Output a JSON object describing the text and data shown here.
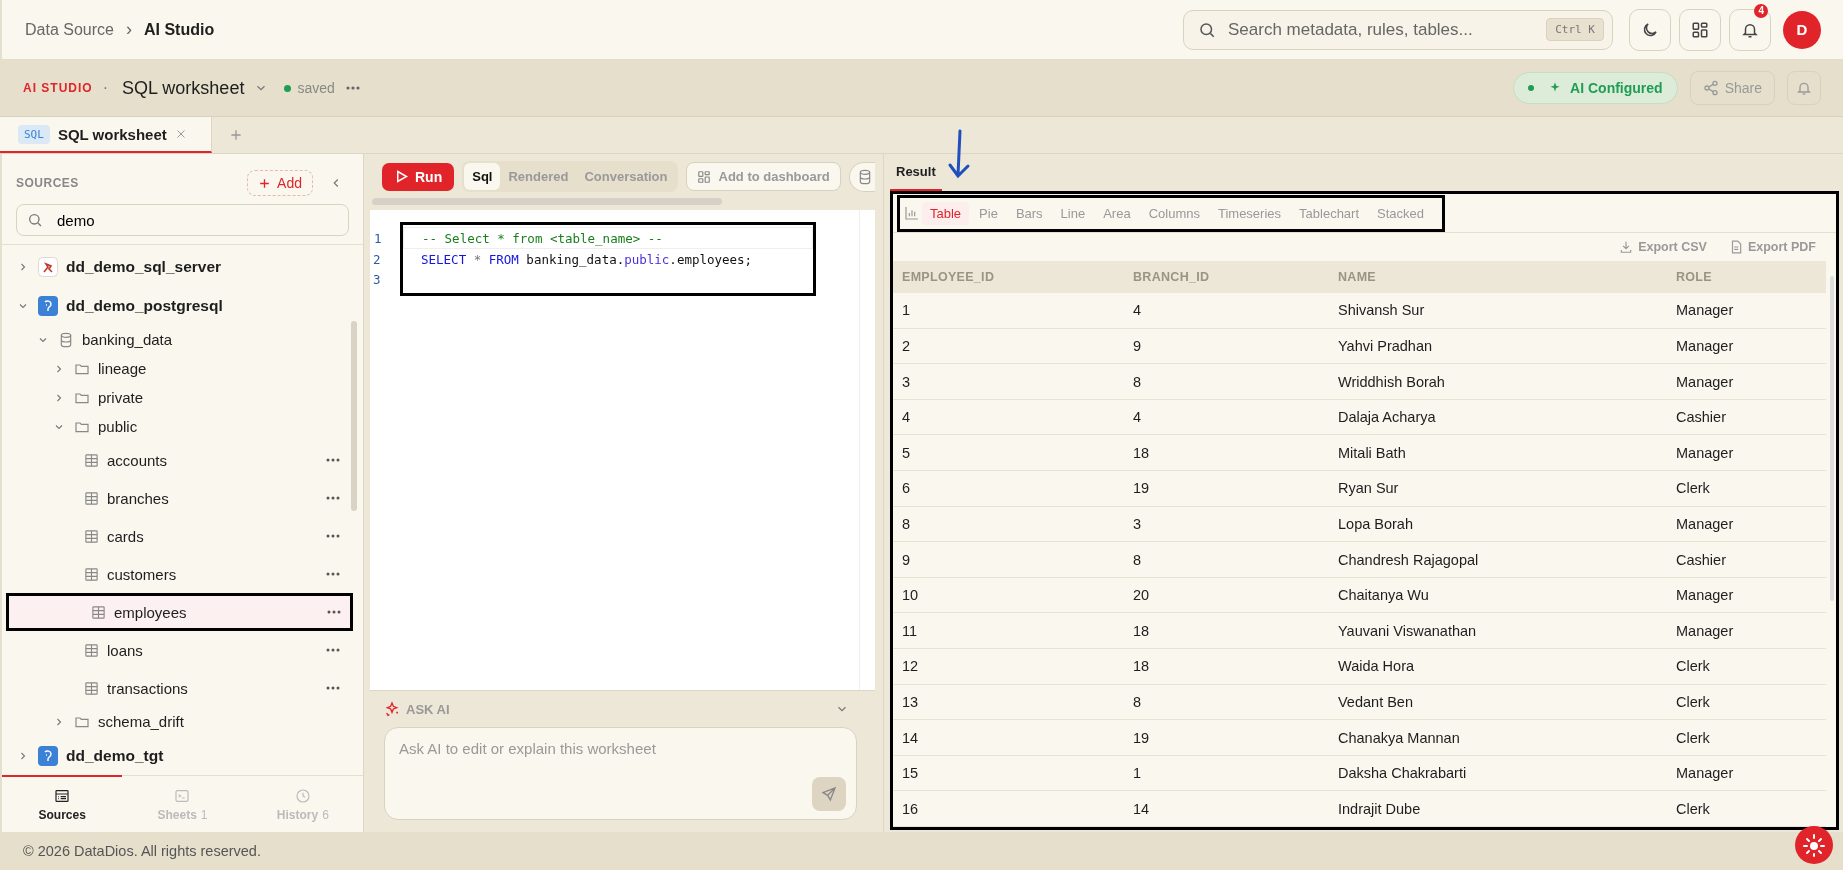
{
  "breadcrumb": {
    "parent": "Data Source",
    "separator": "›",
    "current": "AI Studio"
  },
  "search": {
    "placeholder": "Search metadata, rules, tables...",
    "shortcut": "Ctrl K"
  },
  "notifications": {
    "count": "4"
  },
  "avatar": {
    "initial": "D"
  },
  "worksheet_bar": {
    "brand": "AI STUDIO",
    "dot": "·",
    "title": "SQL worksheet",
    "status": "saved",
    "ai_status": "AI Configured",
    "share": "Share"
  },
  "tabs": [
    {
      "badge": "SQL",
      "label": "SQL worksheet",
      "selected": true
    }
  ],
  "sidebar": {
    "title": "SOURCES",
    "add": "Add",
    "search_value": "demo",
    "tree": [
      {
        "label": "dd_demo_sql_server",
        "kind": "sqlserver",
        "expanded": false
      },
      {
        "label": "dd_demo_postgresql",
        "kind": "postgres",
        "expanded": true,
        "children": [
          {
            "label": "banking_data",
            "kind": "database",
            "expanded": true,
            "children": [
              {
                "label": "lineage",
                "kind": "folder",
                "expanded": false
              },
              {
                "label": "private",
                "kind": "folder",
                "expanded": false
              },
              {
                "label": "public",
                "kind": "folder",
                "expanded": true,
                "children": [
                  {
                    "label": "accounts",
                    "kind": "table",
                    "selected": false,
                    "highlighted": false
                  },
                  {
                    "label": "branches",
                    "kind": "table",
                    "selected": false,
                    "highlighted": false
                  },
                  {
                    "label": "cards",
                    "kind": "table",
                    "selected": false,
                    "highlighted": false
                  },
                  {
                    "label": "customers",
                    "kind": "table",
                    "selected": false,
                    "highlighted": false
                  },
                  {
                    "label": "employees",
                    "kind": "table",
                    "selected": true,
                    "highlighted": true
                  },
                  {
                    "label": "loans",
                    "kind": "table",
                    "selected": false,
                    "highlighted": false
                  },
                  {
                    "label": "transactions",
                    "kind": "table",
                    "selected": false,
                    "highlighted": false
                  }
                ]
              },
              {
                "label": "schema_drift",
                "kind": "folder",
                "expanded": false
              }
            ]
          }
        ]
      },
      {
        "label": "dd_demo_tgt",
        "kind": "postgres",
        "expanded": false
      }
    ],
    "bottom_tabs": [
      {
        "label": "Sources",
        "kind": "sources",
        "selected": true
      },
      {
        "label": "Sheets",
        "count": "1",
        "kind": "sheets",
        "selected": false
      },
      {
        "label": "History",
        "count": "6",
        "kind": "history",
        "selected": false
      }
    ]
  },
  "editor": {
    "run": "Run",
    "modes": [
      {
        "label": "Sql",
        "selected": true
      },
      {
        "label": "Rendered",
        "selected": false
      },
      {
        "label": "Conversation",
        "selected": false
      }
    ],
    "add_dashboard": "Add to dashboard",
    "framed": true,
    "lines": [
      {
        "number": "1",
        "tokens": [
          {
            "kind": "comment",
            "text": "-- Select * from <table_name> --"
          }
        ]
      },
      {
        "number": "2",
        "tokens": [
          {
            "kind": "keyword",
            "text": "SELECT"
          },
          {
            "kind": "operator",
            "text": " * "
          },
          {
            "kind": "keyword",
            "text": "FROM"
          },
          {
            "kind": "plain",
            "text": " banking_data."
          },
          {
            "kind": "schema",
            "text": "public"
          },
          {
            "kind": "plain",
            "text": ".employees;"
          }
        ]
      },
      {
        "number": "3"
      }
    ],
    "ask_ai": {
      "title": "ASK AI",
      "placeholder": "Ask AI to edit or explain this worksheet"
    }
  },
  "result": {
    "tab": "Result",
    "framed": true,
    "arrow": true,
    "chart_tabs_framed": true,
    "chart_types": [
      {
        "label": "Table",
        "selected": true
      },
      {
        "label": "Pie",
        "selected": false
      },
      {
        "label": "Bars",
        "selected": false
      },
      {
        "label": "Line",
        "selected": false
      },
      {
        "label": "Area",
        "selected": false
      },
      {
        "label": "Columns",
        "selected": false
      },
      {
        "label": "Timeseries",
        "selected": false
      },
      {
        "label": "Tablechart",
        "selected": false
      },
      {
        "label": "Stacked",
        "selected": false
      }
    ],
    "exports": [
      {
        "label": "Export CSV",
        "kind": "download"
      },
      {
        "label": "Export PDF",
        "kind": "document"
      }
    ],
    "columns": [
      "EMPLOYEE_ID",
      "BRANCH_ID",
      "NAME",
      "ROLE"
    ],
    "rows": [
      [
        "1",
        "4",
        "Shivansh Sur",
        "Manager"
      ],
      [
        "2",
        "9",
        "Yahvi Pradhan",
        "Manager"
      ],
      [
        "3",
        "8",
        "Wriddhish Borah",
        "Manager"
      ],
      [
        "4",
        "4",
        "Dalaja Acharya",
        "Cashier"
      ],
      [
        "5",
        "18",
        "Mitali Bath",
        "Manager"
      ],
      [
        "6",
        "19",
        "Ryan Sur",
        "Clerk"
      ],
      [
        "8",
        "3",
        "Lopa Borah",
        "Manager"
      ],
      [
        "9",
        "8",
        "Chandresh Rajagopal",
        "Cashier"
      ],
      [
        "10",
        "20",
        "Chaitanya Wu",
        "Manager"
      ],
      [
        "11",
        "18",
        "Yauvani Viswanathan",
        "Manager"
      ],
      [
        "12",
        "18",
        "Waida Hora",
        "Clerk"
      ],
      [
        "13",
        "8",
        "Vedant Ben",
        "Clerk"
      ],
      [
        "14",
        "19",
        "Chanakya Mannan",
        "Clerk"
      ],
      [
        "15",
        "1",
        "Daksha Chakrabarti",
        "Manager"
      ],
      [
        "16",
        "14",
        "Indrajit Dube",
        "Clerk"
      ]
    ]
  },
  "footer": "© 2026 DataDios. All rights reserved."
}
